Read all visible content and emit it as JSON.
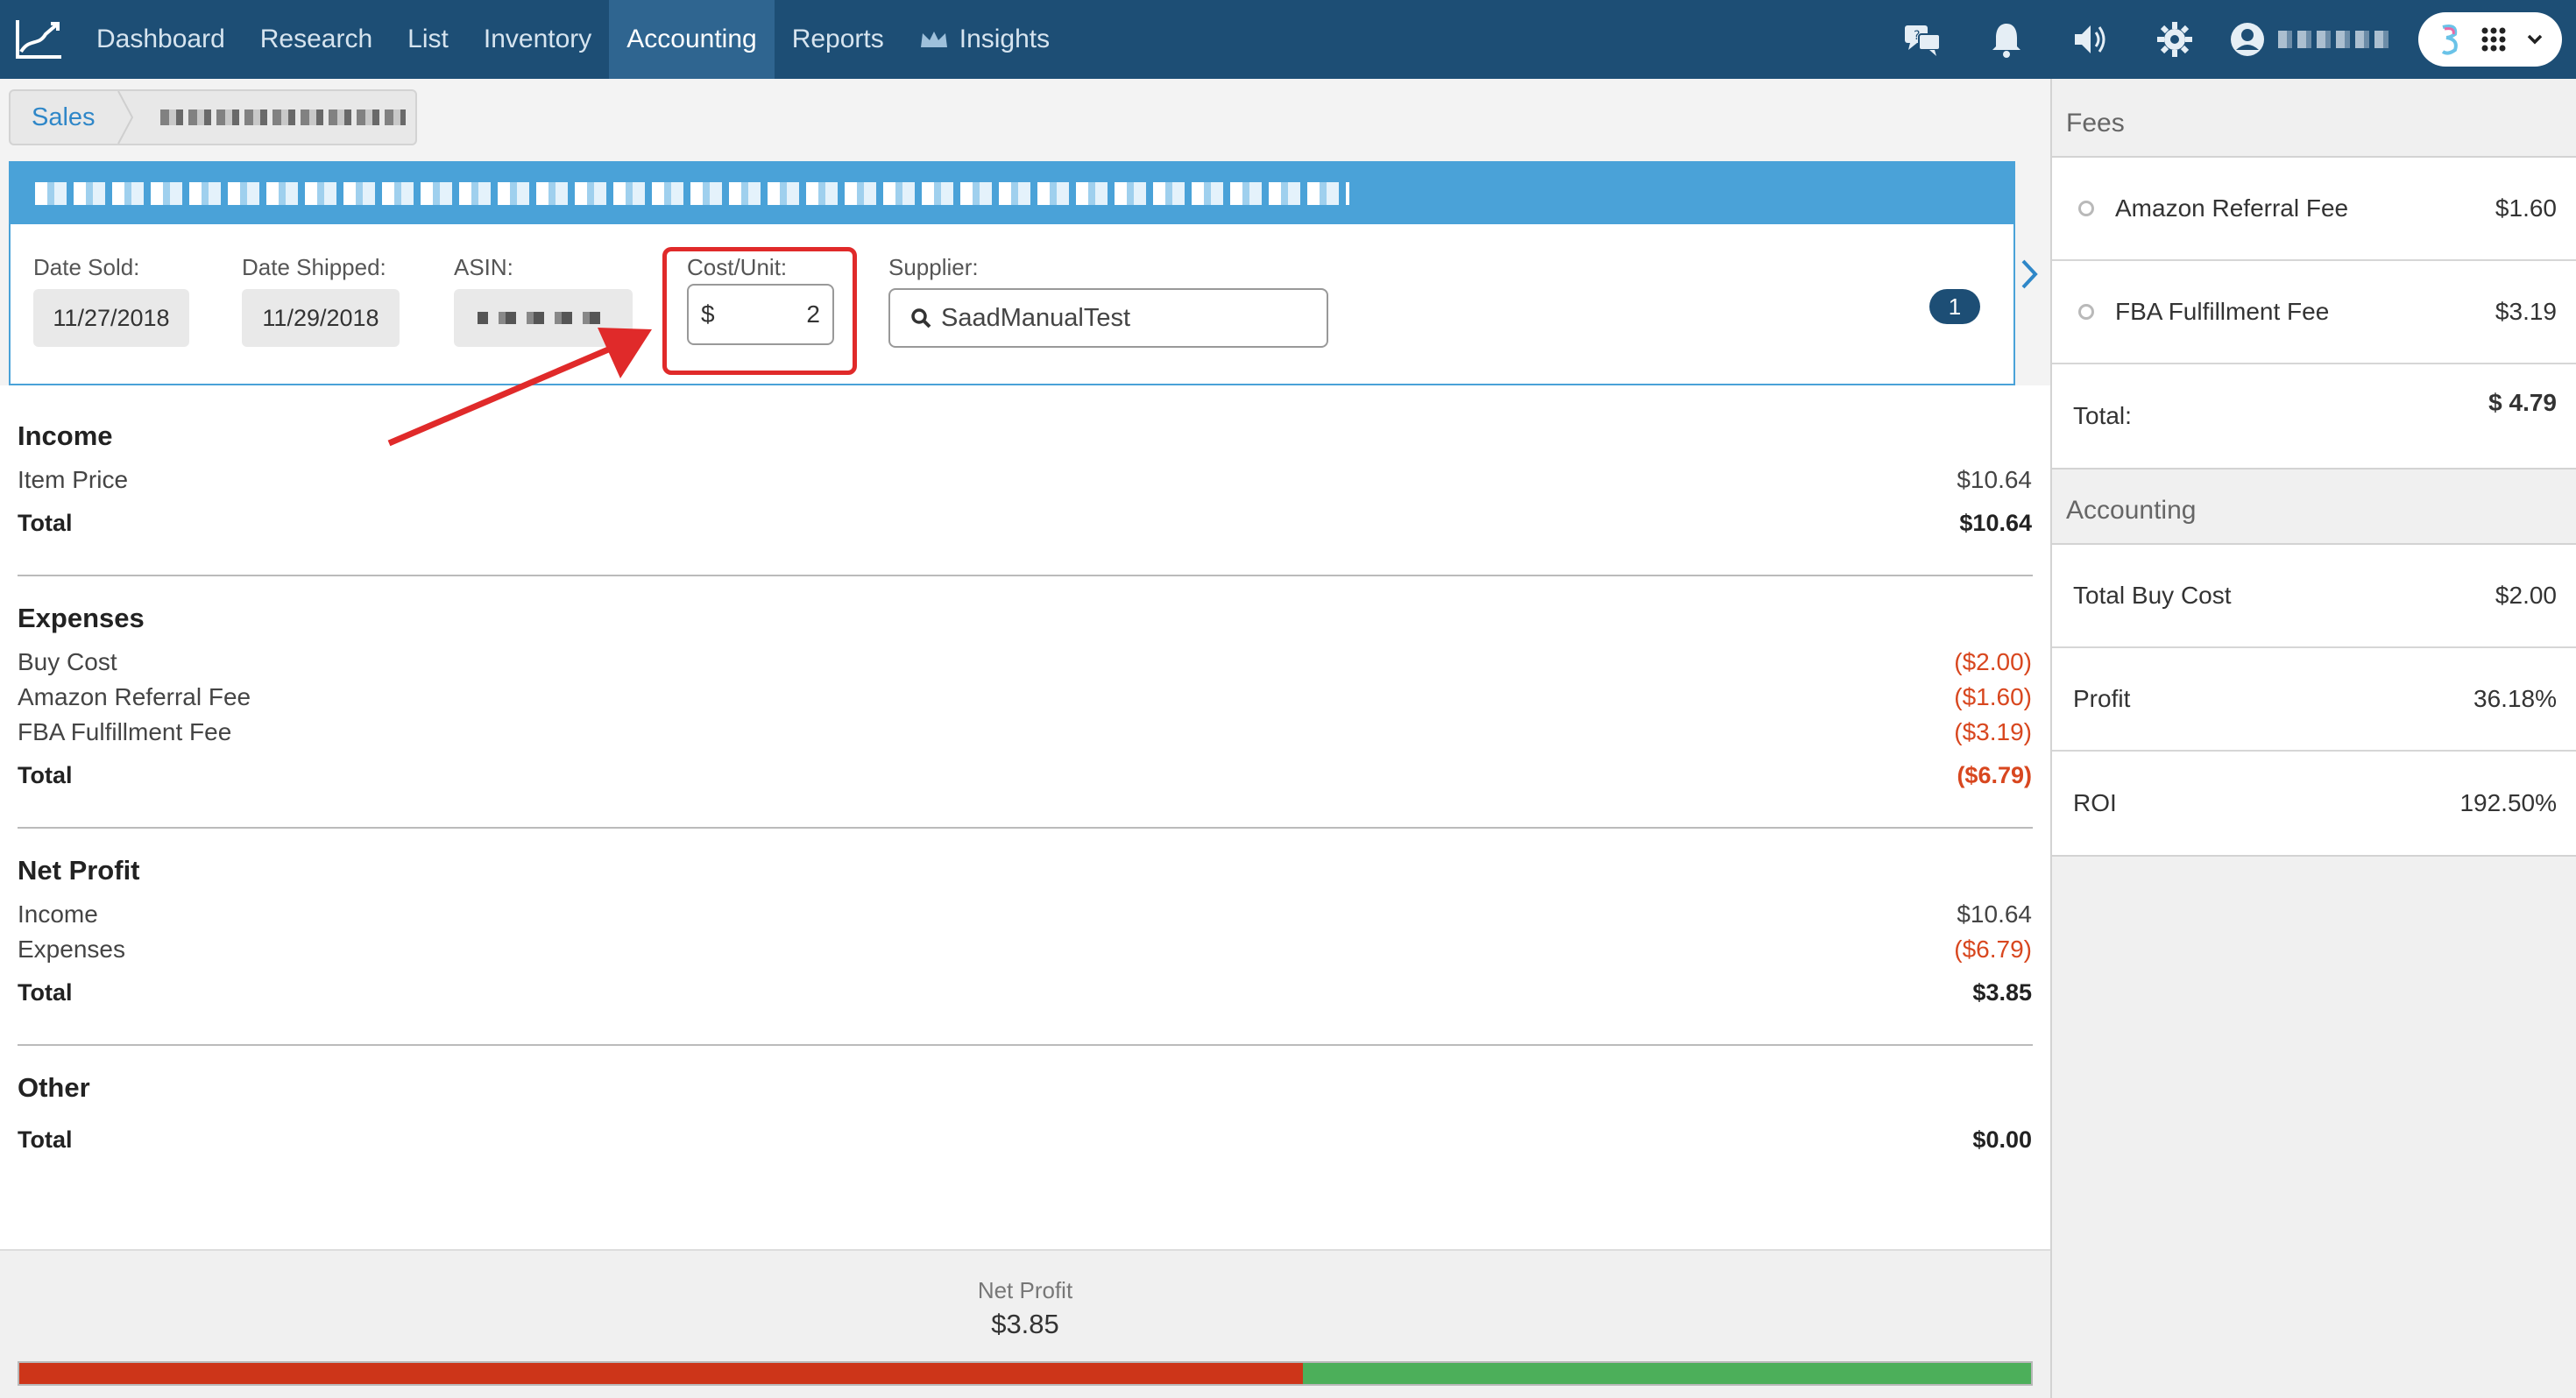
{
  "nav": {
    "items": [
      {
        "label": "Dashboard",
        "active": false
      },
      {
        "label": "Research",
        "active": false
      },
      {
        "label": "List",
        "active": false
      },
      {
        "label": "Inventory",
        "active": false
      },
      {
        "label": "Accounting",
        "active": true
      },
      {
        "label": "Reports",
        "active": false
      },
      {
        "label": "Insights",
        "active": false,
        "icon": "crown-icon"
      }
    ],
    "right_icons": [
      "chat-bubbles-icon",
      "bell-icon",
      "speaker-icon",
      "gear-icon",
      "user-avatar-icon"
    ],
    "app_icons": [
      "app-logo-icon",
      "grid-icon",
      "chevron-down-icon"
    ]
  },
  "breadcrumb": {
    "first": "Sales"
  },
  "product": {
    "date_sold_label": "Date Sold:",
    "date_sold": "11/27/2018",
    "date_shipped_label": "Date Shipped:",
    "date_shipped": "11/29/2018",
    "asin_label": "ASIN:",
    "cost_label": "Cost/Unit:",
    "cost_prefix": "$",
    "cost_value": "2",
    "supplier_label": "Supplier:",
    "supplier_value": "SaadManualTest",
    "badge": "1"
  },
  "income": {
    "heading": "Income",
    "rows": [
      {
        "label": "Item Price",
        "value": "$10.64"
      }
    ],
    "total_label": "Total",
    "total_value": "$10.64"
  },
  "expenses": {
    "heading": "Expenses",
    "rows": [
      {
        "label": "Buy Cost",
        "value": "($2.00)"
      },
      {
        "label": "Amazon Referral Fee",
        "value": "($1.60)"
      },
      {
        "label": "FBA Fulfillment Fee",
        "value": "($3.19)"
      }
    ],
    "total_label": "Total",
    "total_value": "($6.79)"
  },
  "net_profit": {
    "heading": "Net Profit",
    "rows": [
      {
        "label": "Income",
        "value": "$10.64"
      },
      {
        "label": "Expenses",
        "value": "($6.79)"
      }
    ],
    "total_label": "Total",
    "total_value": "$3.85"
  },
  "other": {
    "heading": "Other",
    "total_label": "Total",
    "total_value": "$0.00"
  },
  "footer": {
    "label": "Net Profit",
    "value": "$3.85",
    "expense_share": 0.638
  },
  "fees_panel": {
    "heading": "Fees",
    "rows": [
      {
        "label": "Amazon Referral Fee",
        "value": "$1.60"
      },
      {
        "label": "FBA Fulfillment Fee",
        "value": "$3.19"
      }
    ],
    "total_label": "Total:",
    "total_value": "$ 4.79"
  },
  "accounting_panel": {
    "heading": "Accounting",
    "rows": [
      {
        "label": "Total Buy Cost",
        "value": "$2.00"
      },
      {
        "label": "Profit",
        "value": "36.18%"
      },
      {
        "label": "ROI",
        "value": "192.50%"
      }
    ]
  },
  "colors": {
    "nav_bg": "#1d4e75",
    "nav_active": "#2f6590",
    "card_header": "#4aa2d8",
    "negative": "#d8471f",
    "expense_bar": "#cd3519",
    "income_bar": "#4caf5a",
    "highlight": "#e02a2a"
  }
}
